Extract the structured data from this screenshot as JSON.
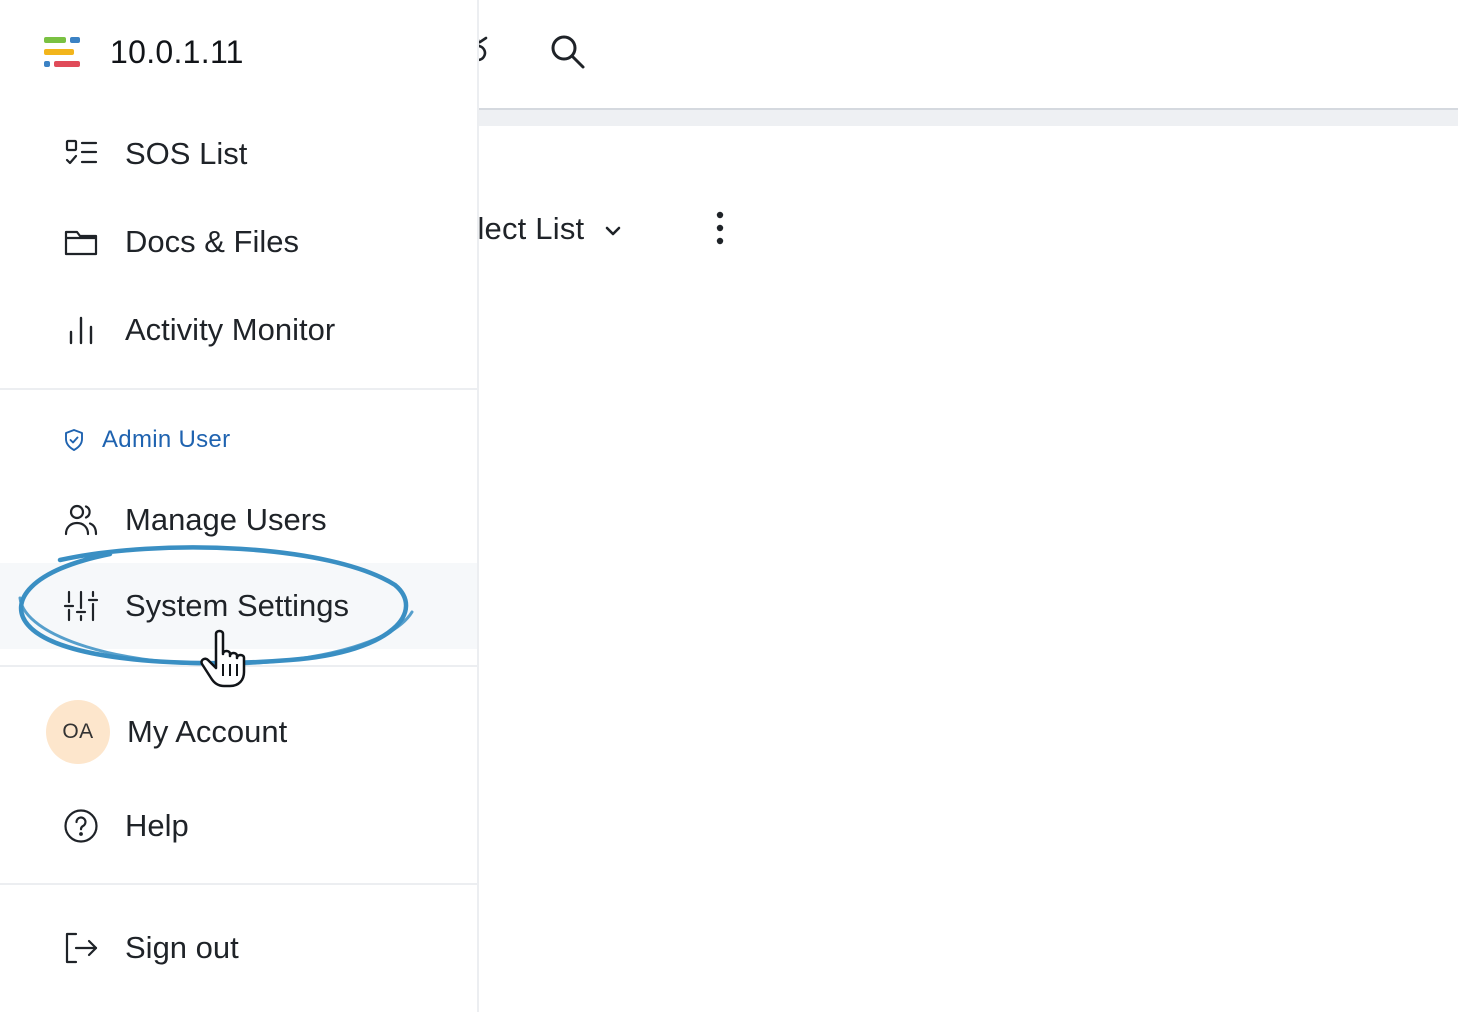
{
  "app": {
    "title": "10.0.1.11",
    "brand_colors": [
      "#7ac142",
      "#f2b51c",
      "#3b82c4",
      "#e04b59"
    ]
  },
  "main": {
    "toolbar": {
      "partial_icon": "share-icon",
      "search_icon": "search-icon"
    },
    "list_select": {
      "label": "elect List",
      "chevron": "chevron-down-icon"
    },
    "more_icon": "more-vertical-icon"
  },
  "sidebar": {
    "primary": [
      {
        "label": "SOS List",
        "icon": "checklist-icon"
      },
      {
        "label": "Docs & Files",
        "icon": "folder-icon"
      },
      {
        "label": "Activity Monitor",
        "icon": "bar-chart-icon"
      }
    ],
    "admin_section": {
      "label": "Admin User",
      "icon": "shield-check-icon",
      "color": "#1f63b0"
    },
    "admin": [
      {
        "label": "Manage Users",
        "icon": "users-icon"
      },
      {
        "label": "System Settings",
        "icon": "sliders-icon",
        "active": true
      }
    ],
    "account": {
      "avatar_initials": "OA",
      "avatar_color": "#fde6cc",
      "label": "My Account"
    },
    "help": {
      "label": "Help",
      "icon": "help-circle-icon"
    },
    "signout": {
      "label": "Sign out",
      "icon": "sign-out-icon"
    }
  },
  "annotation": {
    "highlight_color": "#3a8fc3",
    "cursor": "hand-pointer-icon"
  }
}
